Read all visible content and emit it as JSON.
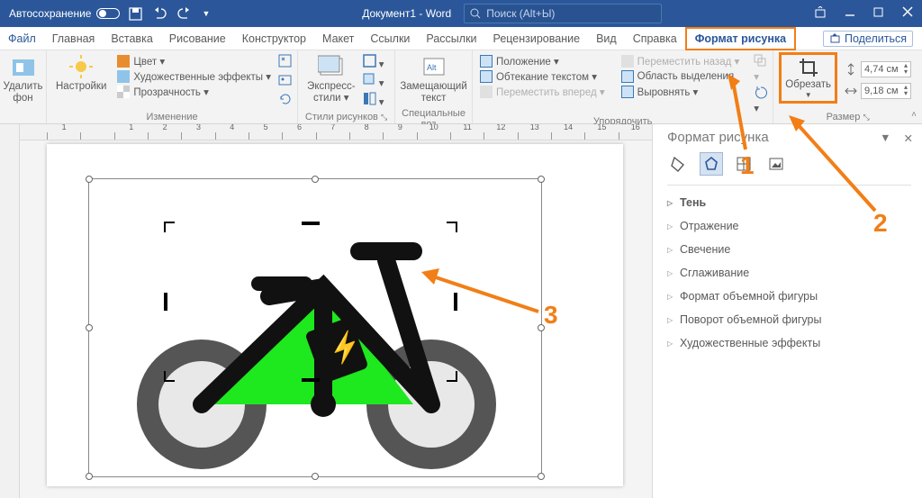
{
  "titlebar": {
    "autosave": "Автосохранение",
    "doc": "Документ1 - Word",
    "search_placeholder": "Поиск (Alt+Ы)"
  },
  "tabs": {
    "file": "Файл",
    "home": "Главная",
    "insert": "Вставка",
    "draw": "Рисование",
    "design": "Конструктор",
    "layout": "Макет",
    "references": "Ссылки",
    "mailings": "Рассылки",
    "review": "Рецензирование",
    "view": "Вид",
    "help": "Справка",
    "picture_format": "Формат рисунка",
    "share": "Поделиться"
  },
  "ribbon": {
    "remove_bg": "Удалить\nфон",
    "corrections": "Настройки",
    "color": "Цвет ▾",
    "artistic": "Художественные эффекты ▾",
    "transparency": "Прозрачность ▾",
    "group_adjust": "Изменение",
    "express_styles": "Экспресс-\nстили ▾",
    "group_styles": "Стили рисунков",
    "alt_text": "Замещающий\nтекст",
    "group_access": "Специальные воз…",
    "position": "Положение ▾",
    "wrap": "Обтекание текстом ▾",
    "forward": "Переместить вперед ▾",
    "backward": "Переместить назад ▾",
    "selection_pane": "Область выделения",
    "align": "Выровнять ▾",
    "group_arrange": "Упорядочить",
    "crop": "Обрезать",
    "height": "4,74 см",
    "width": "9,18 см",
    "group_size": "Размер"
  },
  "pane": {
    "title": "Формат рисунка",
    "items": [
      "Тень",
      "Отражение",
      "Свечение",
      "Сглаживание",
      "Формат объемной фигуры",
      "Поворот объемной фигуры",
      "Художественные эффекты"
    ]
  },
  "annotations": {
    "n1": "1",
    "n2": "2",
    "n3": "3"
  },
  "ruler": [
    "1",
    "",
    "1",
    "2",
    "3",
    "4",
    "5",
    "6",
    "7",
    "8",
    "9",
    "10",
    "11",
    "12",
    "13",
    "14",
    "15",
    "16"
  ]
}
